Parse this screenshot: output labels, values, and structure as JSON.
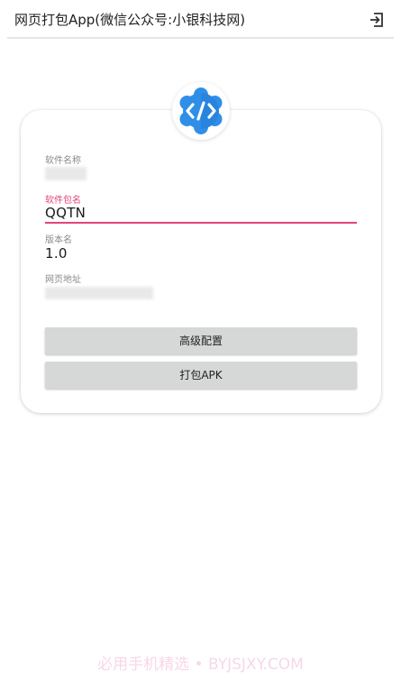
{
  "appbar": {
    "title": "网页打包App(微信公众号:小银科技网)",
    "exit_icon": "exit-to-app-icon"
  },
  "logo": {
    "icon": "code-brackets-icon",
    "colors": {
      "primary": "#2f8fe8",
      "dark": "#1f6fcf",
      "light": "#ffffff"
    }
  },
  "form": {
    "app_name": {
      "label": "软件名称",
      "value": ""
    },
    "package_name": {
      "label": "软件包名",
      "value": "QQTN"
    },
    "version_name": {
      "label": "版本名",
      "value": "1.0"
    },
    "web_url": {
      "label": "网页地址",
      "value": ""
    }
  },
  "buttons": {
    "advanced_label": "高级配置",
    "build_label": "打包APK"
  },
  "watermark": "必用手机精选 • BYJSJXY.COM",
  "colors": {
    "accent": "#e0457b",
    "button_bg": "#d6d7d7",
    "label": "#8a8a8a"
  }
}
